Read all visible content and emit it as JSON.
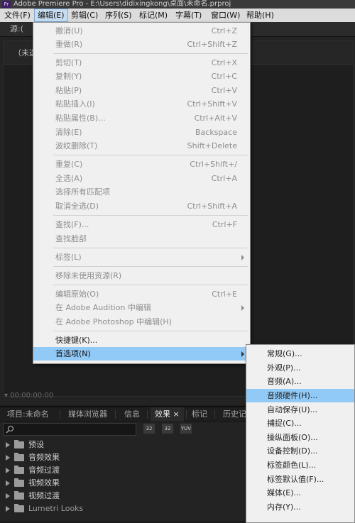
{
  "window": {
    "title": "Adobe Premiere Pro - E:\\Users\\didixingkong\\桌面\\未命名.prproj",
    "app_icon": "Pr"
  },
  "menubar": {
    "items": [
      {
        "label": "文件(F)"
      },
      {
        "label": "编辑(E)",
        "active": true
      },
      {
        "label": "剪辑(C)"
      },
      {
        "label": "序列(S)"
      },
      {
        "label": "标记(M)"
      },
      {
        "label": "字幕(T)"
      },
      {
        "label": "窗口(W)"
      },
      {
        "label": "帮助(H)"
      }
    ]
  },
  "source_panel": {
    "tab": "源:(",
    "title": "（未选",
    "timecode": "00:00:00:00"
  },
  "edit_menu": {
    "items": [
      {
        "label": "撤消(U)",
        "shortcut": "Ctrl+Z",
        "disabled": true
      },
      {
        "label": "重做(R)",
        "shortcut": "Ctrl+Shift+Z",
        "disabled": true
      },
      {
        "label": "剪切(T)",
        "shortcut": "Ctrl+X",
        "disabled": true
      },
      {
        "label": "复制(Y)",
        "shortcut": "Ctrl+C",
        "disabled": true
      },
      {
        "label": "粘贴(P)",
        "shortcut": "Ctrl+V",
        "disabled": true
      },
      {
        "label": "粘贴插入(I)",
        "shortcut": "Ctrl+Shift+V",
        "disabled": true
      },
      {
        "label": "粘贴属性(B)...",
        "shortcut": "Ctrl+Alt+V",
        "disabled": true
      },
      {
        "label": "清除(E)",
        "shortcut": "Backspace",
        "disabled": true
      },
      {
        "label": "波纹删除(T)",
        "shortcut": "Shift+Delete",
        "disabled": true
      },
      {
        "label": "重复(C)",
        "shortcut": "Ctrl+Shift+/",
        "disabled": true
      },
      {
        "label": "全选(A)",
        "shortcut": "Ctrl+A",
        "disabled": true
      },
      {
        "label": "选择所有匹配项",
        "shortcut": "",
        "disabled": true
      },
      {
        "label": "取消全选(D)",
        "shortcut": "Ctrl+Shift+A",
        "disabled": true
      },
      {
        "label": "查找(F)...",
        "shortcut": "Ctrl+F",
        "disabled": true
      },
      {
        "label": "查找脸部",
        "shortcut": "",
        "disabled": true
      },
      {
        "label": "标签(L)",
        "shortcut": "",
        "disabled": true,
        "submenu": true
      },
      {
        "label": "移除未使用资源(R)",
        "shortcut": "",
        "disabled": true
      },
      {
        "label": "编辑原始(O)",
        "shortcut": "Ctrl+E",
        "disabled": true
      },
      {
        "label": "在 Adobe Audition 中编辑",
        "shortcut": "",
        "disabled": true,
        "submenu": true
      },
      {
        "label": "在 Adobe Photoshop 中编辑(H)",
        "shortcut": "",
        "disabled": true
      },
      {
        "label": "快捷键(K)...",
        "shortcut": "",
        "disabled": false
      },
      {
        "label": "首选项(N)",
        "shortcut": "",
        "disabled": false,
        "submenu": true,
        "highlighted": true
      }
    ]
  },
  "preferences_submenu": {
    "items": [
      {
        "label": "常规(G)..."
      },
      {
        "label": "外观(P)..."
      },
      {
        "label": "音频(A)..."
      },
      {
        "label": "音频硬件(H)...",
        "highlighted": true
      },
      {
        "label": "自动保存(U)..."
      },
      {
        "label": "捕捉(C)..."
      },
      {
        "label": "操纵面板(O)..."
      },
      {
        "label": "设备控制(D)..."
      },
      {
        "label": "标签颜色(L)..."
      },
      {
        "label": "标签默认值(F)..."
      },
      {
        "label": "媒体(E)..."
      },
      {
        "label": "内存(Y)..."
      }
    ]
  },
  "bottom_panel": {
    "tabs": [
      {
        "label": "项目:未命名"
      },
      {
        "label": "媒体浏览器"
      },
      {
        "label": "信息"
      },
      {
        "label": "效果",
        "active": true
      },
      {
        "label": "标记"
      },
      {
        "label": "历史记"
      }
    ],
    "tab_close": "×",
    "search_placeholder": "",
    "tool_buttons": [
      "32",
      "32",
      "YUV"
    ],
    "tree": [
      {
        "label": "预设"
      },
      {
        "label": "音频效果"
      },
      {
        "label": "音频过渡"
      },
      {
        "label": "视频效果"
      },
      {
        "label": "视频过渡"
      },
      {
        "label": "Lumetri Looks"
      }
    ]
  }
}
